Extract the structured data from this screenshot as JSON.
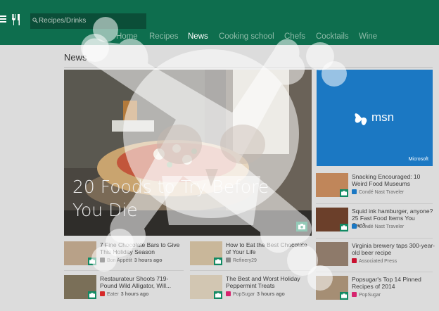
{
  "header": {
    "search_placeholder": "Recipes/Drinks",
    "nav": [
      {
        "label": "Home",
        "active": false
      },
      {
        "label": "Recipes",
        "active": false
      },
      {
        "label": "News",
        "active": true
      },
      {
        "label": "Cooking school",
        "active": false
      },
      {
        "label": "Chefs",
        "active": false
      },
      {
        "label": "Cocktails",
        "active": false
      },
      {
        "label": "Wine",
        "active": false
      }
    ]
  },
  "section": {
    "title": "News"
  },
  "hero": {
    "title": "20 Foods to Try Before You Die"
  },
  "ad": {
    "logo_text": "msn",
    "brand": "Microsoft"
  },
  "right_cards": [
    {
      "title": "Snacking Encouraged: 10 Weird Food Museums",
      "source": "Condé Nast Traveler",
      "time": ""
    },
    {
      "title": "Squid ink hamburger, anyone? 25 Fast Food Items You Can't...",
      "source": "Condé Nast Traveler",
      "time": ""
    },
    {
      "title": "Virginia brewery taps 300-year-old beer recipe",
      "source": "Associated Press",
      "time": ""
    },
    {
      "title": "Popsugar's Top 14 Pinned Recipes of 2014",
      "source": "PopSugar",
      "time": ""
    }
  ],
  "bottom_cards": [
    {
      "title": "7 Fine Chocolate Bars to Give This Holiday Season",
      "source": "Bon Appétit",
      "time": "3 hours ago"
    },
    {
      "title": "How to Eat the Best Chocolate of Your Life",
      "source": "Refinery29",
      "time": ""
    },
    {
      "title": "Restaurateur Shoots 719-Pound Wild Alligator, Will...",
      "source": "Eater",
      "time": "3 hours ago"
    },
    {
      "title": "The Best and Worst Holiday Peppermint Treats",
      "source": "PopSugar",
      "time": "3 hours ago"
    }
  ],
  "colors": {
    "header": "#0e6e4e",
    "accent": "#128a63",
    "ad": "#1b78c3"
  }
}
